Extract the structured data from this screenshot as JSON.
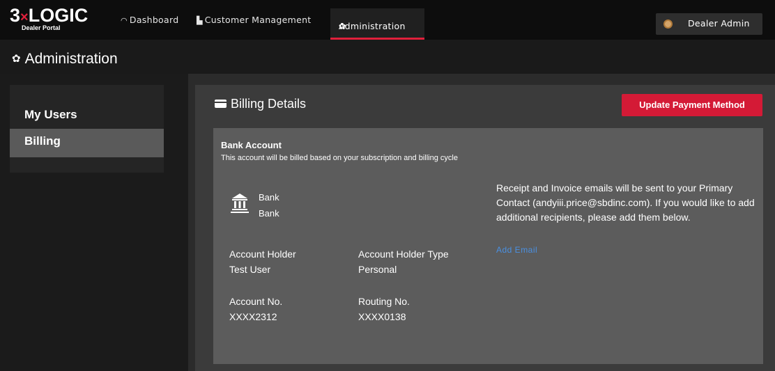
{
  "header": {
    "logo_main": "3×LOGIC",
    "logo_sub": "Dealer Portal",
    "nav": [
      {
        "label": "Dashboard",
        "icon": "dashboard-icon"
      },
      {
        "label": "Customer Management",
        "icon": "building-icon"
      },
      {
        "label": "Administration",
        "icon": "gear-icon"
      }
    ],
    "user_label": "Dealer Admin"
  },
  "page": {
    "title": "Administration"
  },
  "sidebar": {
    "items": [
      {
        "label": "My Users"
      },
      {
        "label": "Billing"
      }
    ]
  },
  "billing": {
    "title": "Billing Details",
    "update_button": "Update Payment Method",
    "bank_account": {
      "title": "Bank Account",
      "subtitle": "This account will be billed based on your subscription and billing cycle",
      "bank_name_1": "Bank",
      "bank_name_2": "Bank",
      "holder_label": "Account Holder",
      "holder_value": "Test User",
      "type_label": "Account Holder Type",
      "type_value": "Personal",
      "acct_label": "Account No.",
      "acct_value": "XXXX2312",
      "routing_label": "Routing No.",
      "routing_value": "XXXX0138",
      "note": "Receipt and Invoice emails will be sent to your Primary Contact (andyiii.price@sbdinc.com). If you would like to add additional recipients, please add them below.",
      "add_email": "Add Email"
    }
  },
  "colors": {
    "accent": "#d41a36",
    "link": "#4a90e2",
    "topbar": "#0d0d0d"
  }
}
